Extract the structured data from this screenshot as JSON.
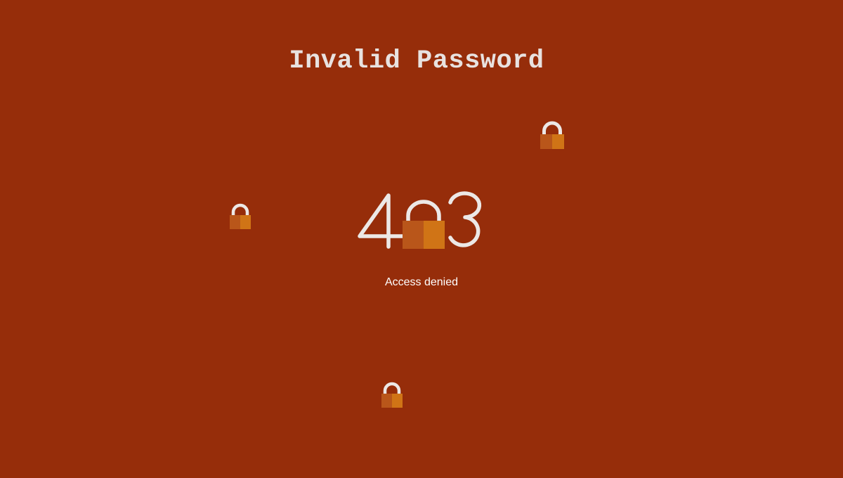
{
  "page": {
    "title": "Invalid Password",
    "status_code": "403",
    "message": "Access denied"
  },
  "icons": {
    "lock": "padlock-icon"
  },
  "colors": {
    "background": "#962d0a",
    "title": "#e8e2e0",
    "digits": "#ece8e6",
    "message": "#ffffff",
    "lock_body_dark": "#b9561a",
    "lock_body_light": "#d07416",
    "lock_shackle": "#ece8e6"
  }
}
